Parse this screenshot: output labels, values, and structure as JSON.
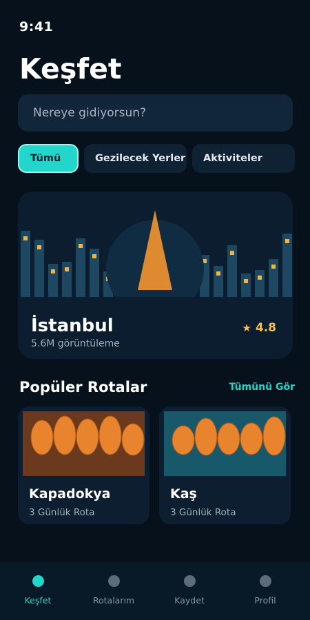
{
  "status": {
    "time": "9:41"
  },
  "header": {
    "title": "Keşfet"
  },
  "search": {
    "placeholder": "Nereye gidiyorsun?"
  },
  "chips": [
    {
      "label": "Tümü",
      "active": true
    },
    {
      "label": "Gezilecek Yerler",
      "active": false
    },
    {
      "label": "Aktiviteler",
      "active": false
    }
  ],
  "featured": {
    "name": "İstanbul",
    "views": "5.6M görüntüleme",
    "rating": "4.8",
    "star_icon": "star-icon"
  },
  "popular": {
    "title": "Popüler Rotalar",
    "see_all": "Tümünü Gör",
    "routes": [
      {
        "name": "Kapadokya",
        "subtitle": "3 Günlük Rota"
      },
      {
        "name": "Kaş",
        "subtitle": "3 Günlük Rota"
      }
    ]
  },
  "tabs": [
    {
      "label": "Keşfet",
      "active": true
    },
    {
      "label": "Rotalarım",
      "active": false
    },
    {
      "label": "Kaydet",
      "active": false
    },
    {
      "label": "Profil",
      "active": false
    }
  ],
  "colors": {
    "background": "#06111c",
    "accent": "#22d6cc",
    "rating": "#f5c14b",
    "balloon": "#e8842d",
    "card": "#0c1e2f"
  }
}
